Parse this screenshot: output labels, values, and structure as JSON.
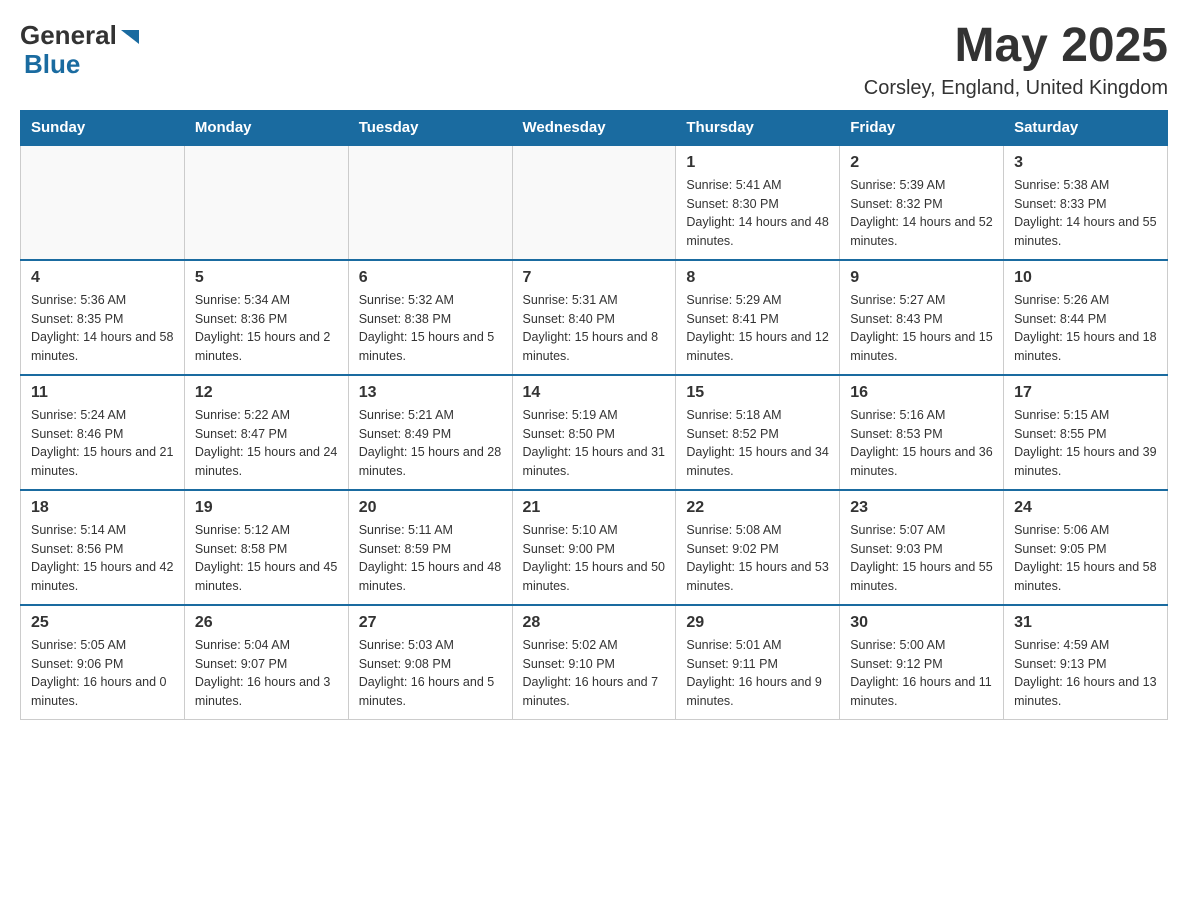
{
  "header": {
    "logo_general": "General",
    "logo_blue": "Blue",
    "month_year": "May 2025",
    "location": "Corsley, England, United Kingdom"
  },
  "weekdays": [
    "Sunday",
    "Monday",
    "Tuesday",
    "Wednesday",
    "Thursday",
    "Friday",
    "Saturday"
  ],
  "weeks": [
    {
      "days": [
        {
          "number": "",
          "sunrise": "",
          "sunset": "",
          "daylight": ""
        },
        {
          "number": "",
          "sunrise": "",
          "sunset": "",
          "daylight": ""
        },
        {
          "number": "",
          "sunrise": "",
          "sunset": "",
          "daylight": ""
        },
        {
          "number": "",
          "sunrise": "",
          "sunset": "",
          "daylight": ""
        },
        {
          "number": "1",
          "sunrise": "Sunrise: 5:41 AM",
          "sunset": "Sunset: 8:30 PM",
          "daylight": "Daylight: 14 hours and 48 minutes."
        },
        {
          "number": "2",
          "sunrise": "Sunrise: 5:39 AM",
          "sunset": "Sunset: 8:32 PM",
          "daylight": "Daylight: 14 hours and 52 minutes."
        },
        {
          "number": "3",
          "sunrise": "Sunrise: 5:38 AM",
          "sunset": "Sunset: 8:33 PM",
          "daylight": "Daylight: 14 hours and 55 minutes."
        }
      ]
    },
    {
      "days": [
        {
          "number": "4",
          "sunrise": "Sunrise: 5:36 AM",
          "sunset": "Sunset: 8:35 PM",
          "daylight": "Daylight: 14 hours and 58 minutes."
        },
        {
          "number": "5",
          "sunrise": "Sunrise: 5:34 AM",
          "sunset": "Sunset: 8:36 PM",
          "daylight": "Daylight: 15 hours and 2 minutes."
        },
        {
          "number": "6",
          "sunrise": "Sunrise: 5:32 AM",
          "sunset": "Sunset: 8:38 PM",
          "daylight": "Daylight: 15 hours and 5 minutes."
        },
        {
          "number": "7",
          "sunrise": "Sunrise: 5:31 AM",
          "sunset": "Sunset: 8:40 PM",
          "daylight": "Daylight: 15 hours and 8 minutes."
        },
        {
          "number": "8",
          "sunrise": "Sunrise: 5:29 AM",
          "sunset": "Sunset: 8:41 PM",
          "daylight": "Daylight: 15 hours and 12 minutes."
        },
        {
          "number": "9",
          "sunrise": "Sunrise: 5:27 AM",
          "sunset": "Sunset: 8:43 PM",
          "daylight": "Daylight: 15 hours and 15 minutes."
        },
        {
          "number": "10",
          "sunrise": "Sunrise: 5:26 AM",
          "sunset": "Sunset: 8:44 PM",
          "daylight": "Daylight: 15 hours and 18 minutes."
        }
      ]
    },
    {
      "days": [
        {
          "number": "11",
          "sunrise": "Sunrise: 5:24 AM",
          "sunset": "Sunset: 8:46 PM",
          "daylight": "Daylight: 15 hours and 21 minutes."
        },
        {
          "number": "12",
          "sunrise": "Sunrise: 5:22 AM",
          "sunset": "Sunset: 8:47 PM",
          "daylight": "Daylight: 15 hours and 24 minutes."
        },
        {
          "number": "13",
          "sunrise": "Sunrise: 5:21 AM",
          "sunset": "Sunset: 8:49 PM",
          "daylight": "Daylight: 15 hours and 28 minutes."
        },
        {
          "number": "14",
          "sunrise": "Sunrise: 5:19 AM",
          "sunset": "Sunset: 8:50 PM",
          "daylight": "Daylight: 15 hours and 31 minutes."
        },
        {
          "number": "15",
          "sunrise": "Sunrise: 5:18 AM",
          "sunset": "Sunset: 8:52 PM",
          "daylight": "Daylight: 15 hours and 34 minutes."
        },
        {
          "number": "16",
          "sunrise": "Sunrise: 5:16 AM",
          "sunset": "Sunset: 8:53 PM",
          "daylight": "Daylight: 15 hours and 36 minutes."
        },
        {
          "number": "17",
          "sunrise": "Sunrise: 5:15 AM",
          "sunset": "Sunset: 8:55 PM",
          "daylight": "Daylight: 15 hours and 39 minutes."
        }
      ]
    },
    {
      "days": [
        {
          "number": "18",
          "sunrise": "Sunrise: 5:14 AM",
          "sunset": "Sunset: 8:56 PM",
          "daylight": "Daylight: 15 hours and 42 minutes."
        },
        {
          "number": "19",
          "sunrise": "Sunrise: 5:12 AM",
          "sunset": "Sunset: 8:58 PM",
          "daylight": "Daylight: 15 hours and 45 minutes."
        },
        {
          "number": "20",
          "sunrise": "Sunrise: 5:11 AM",
          "sunset": "Sunset: 8:59 PM",
          "daylight": "Daylight: 15 hours and 48 minutes."
        },
        {
          "number": "21",
          "sunrise": "Sunrise: 5:10 AM",
          "sunset": "Sunset: 9:00 PM",
          "daylight": "Daylight: 15 hours and 50 minutes."
        },
        {
          "number": "22",
          "sunrise": "Sunrise: 5:08 AM",
          "sunset": "Sunset: 9:02 PM",
          "daylight": "Daylight: 15 hours and 53 minutes."
        },
        {
          "number": "23",
          "sunrise": "Sunrise: 5:07 AM",
          "sunset": "Sunset: 9:03 PM",
          "daylight": "Daylight: 15 hours and 55 minutes."
        },
        {
          "number": "24",
          "sunrise": "Sunrise: 5:06 AM",
          "sunset": "Sunset: 9:05 PM",
          "daylight": "Daylight: 15 hours and 58 minutes."
        }
      ]
    },
    {
      "days": [
        {
          "number": "25",
          "sunrise": "Sunrise: 5:05 AM",
          "sunset": "Sunset: 9:06 PM",
          "daylight": "Daylight: 16 hours and 0 minutes."
        },
        {
          "number": "26",
          "sunrise": "Sunrise: 5:04 AM",
          "sunset": "Sunset: 9:07 PM",
          "daylight": "Daylight: 16 hours and 3 minutes."
        },
        {
          "number": "27",
          "sunrise": "Sunrise: 5:03 AM",
          "sunset": "Sunset: 9:08 PM",
          "daylight": "Daylight: 16 hours and 5 minutes."
        },
        {
          "number": "28",
          "sunrise": "Sunrise: 5:02 AM",
          "sunset": "Sunset: 9:10 PM",
          "daylight": "Daylight: 16 hours and 7 minutes."
        },
        {
          "number": "29",
          "sunrise": "Sunrise: 5:01 AM",
          "sunset": "Sunset: 9:11 PM",
          "daylight": "Daylight: 16 hours and 9 minutes."
        },
        {
          "number": "30",
          "sunrise": "Sunrise: 5:00 AM",
          "sunset": "Sunset: 9:12 PM",
          "daylight": "Daylight: 16 hours and 11 minutes."
        },
        {
          "number": "31",
          "sunrise": "Sunrise: 4:59 AM",
          "sunset": "Sunset: 9:13 PM",
          "daylight": "Daylight: 16 hours and 13 minutes."
        }
      ]
    }
  ]
}
